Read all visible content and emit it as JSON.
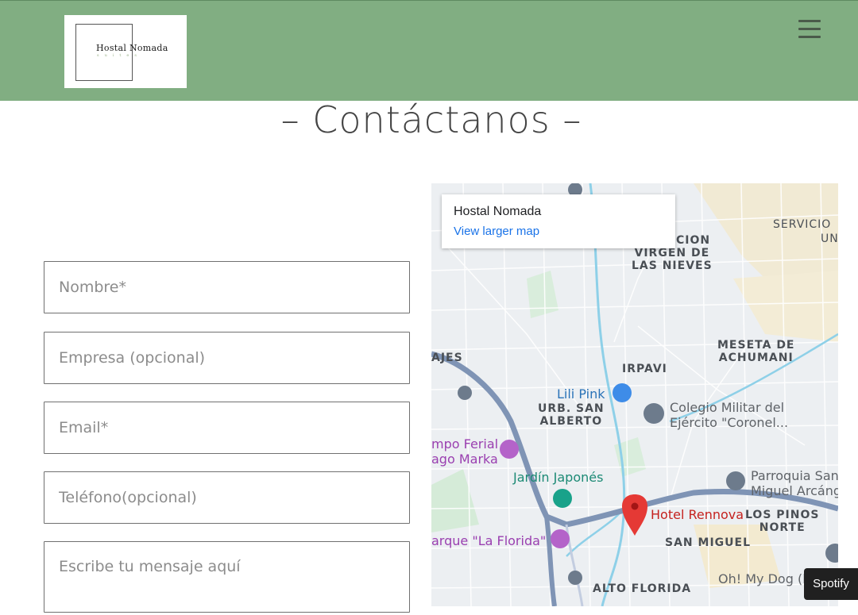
{
  "header": {
    "logo_name": "Hostal Nomada",
    "logo_sub": "suites",
    "menu_icon": "hamburger-menu-icon"
  },
  "page": {
    "title": "– Contáctanos –"
  },
  "form": {
    "name_placeholder": "Nombre*",
    "company_placeholder": "Empresa (opcional)",
    "email_placeholder": "Email*",
    "phone_placeholder": "Teléfono(opcional)",
    "message_placeholder": "Escribe tu mensaje aquí"
  },
  "map": {
    "info_title": "Hostal Nomada",
    "info_link": "View larger map",
    "areas": {
      "zacion": "ZACION",
      "virgen": "VIRGEN DE\nLAS NIEVES",
      "servicio": "SERVICIO",
      "un": "UN",
      "meseta": "MESETA DE\nACHUMANI",
      "irpavi": "IRPAVI",
      "ajes": "AJES",
      "urb": "URB. SAN\nALBERTO",
      "pinos": "LOS PINOS\nNORTE",
      "sanmiguel": "SAN MIGUEL",
      "alto": "ALTO FLORIDA"
    },
    "pois": {
      "lili": "Lili Pink",
      "colegio": "Colegio Militar del\nEjército \"Coronel...",
      "campo": "mpo Ferial\nago Marka",
      "jardin": "Jardín Japonés",
      "parroquia": "Parroquia San\nMiguel Arcáng",
      "hotel": "Hotel Rennova",
      "parque": "arque \"La Florida\"",
      "dog": "Oh! My Dog (l"
    }
  },
  "spotify_label": "Spotify",
  "colors": {
    "header_green": "#81ae82",
    "marker_red": "#e53935"
  }
}
